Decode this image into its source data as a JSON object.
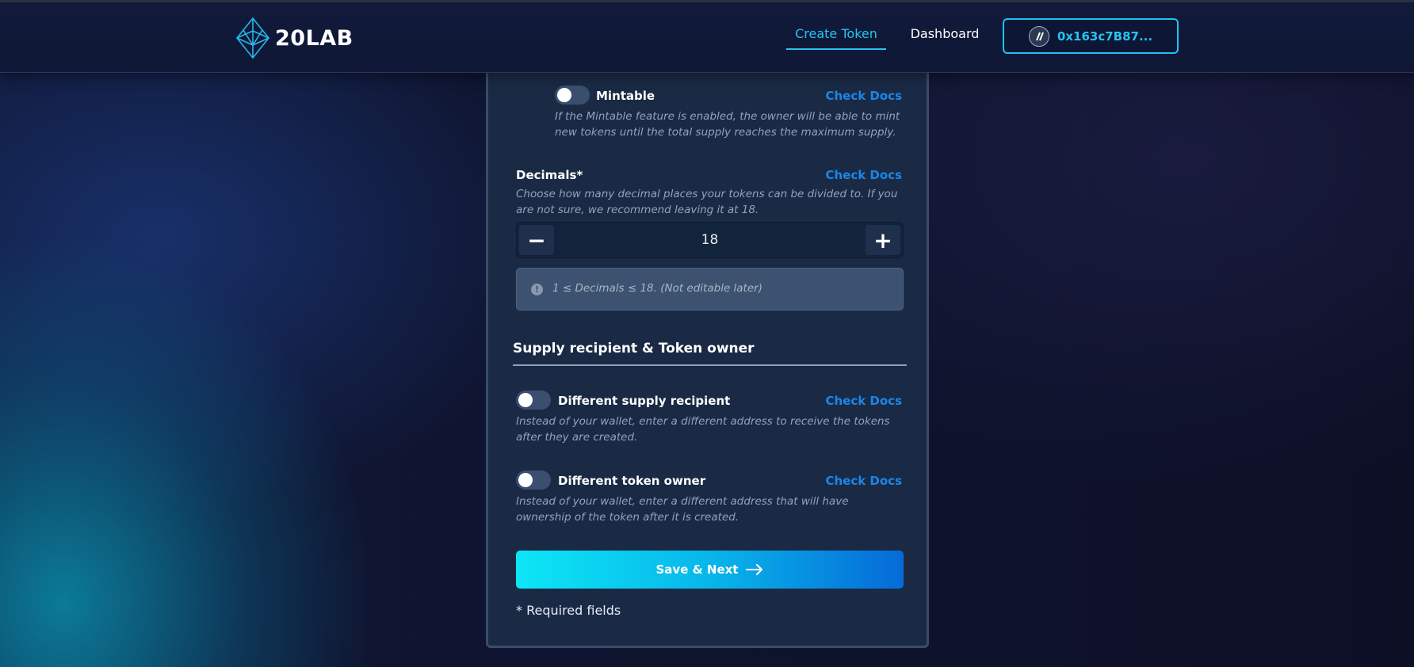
{
  "header": {
    "logo_text": "20LAB",
    "nav": {
      "create_token": "Create Token",
      "dashboard": "Dashboard"
    },
    "wallet": {
      "address": "0x163c7B87...",
      "chain_icon": "arbitrum-icon"
    },
    "accent_color": "#27c3ee"
  },
  "form": {
    "mintable": {
      "label": "Mintable",
      "enabled": false,
      "docs": "Check Docs",
      "description": "If the Mintable feature is enabled, the owner will be able to mint new tokens until the total supply reaches the maximum supply."
    },
    "decimals": {
      "label": "Decimals*",
      "docs": "Check Docs",
      "description": "Choose how many decimal places your tokens can be divided to. If you are not sure, we recommend leaving it at 18.",
      "decrement_symbol": "−",
      "increment_symbol": "+",
      "value": "18",
      "note_icon": "!",
      "note": "1 ≤ Decimals ≤ 18. (Not editable later)"
    },
    "supply_section": {
      "title": "Supply recipient & Token owner"
    },
    "different_supply_recipient": {
      "label": "Different supply recipient",
      "enabled": false,
      "docs": "Check Docs",
      "description": "Instead of your wallet, enter a different address to receive the tokens after they are created."
    },
    "different_token_owner": {
      "label": "Different token owner",
      "enabled": false,
      "docs": "Check Docs",
      "description": "Instead of your wallet, enter a different address that will have ownership of the token after it is created."
    },
    "save_button": "Save & Next",
    "required_note": "* Required fields"
  }
}
